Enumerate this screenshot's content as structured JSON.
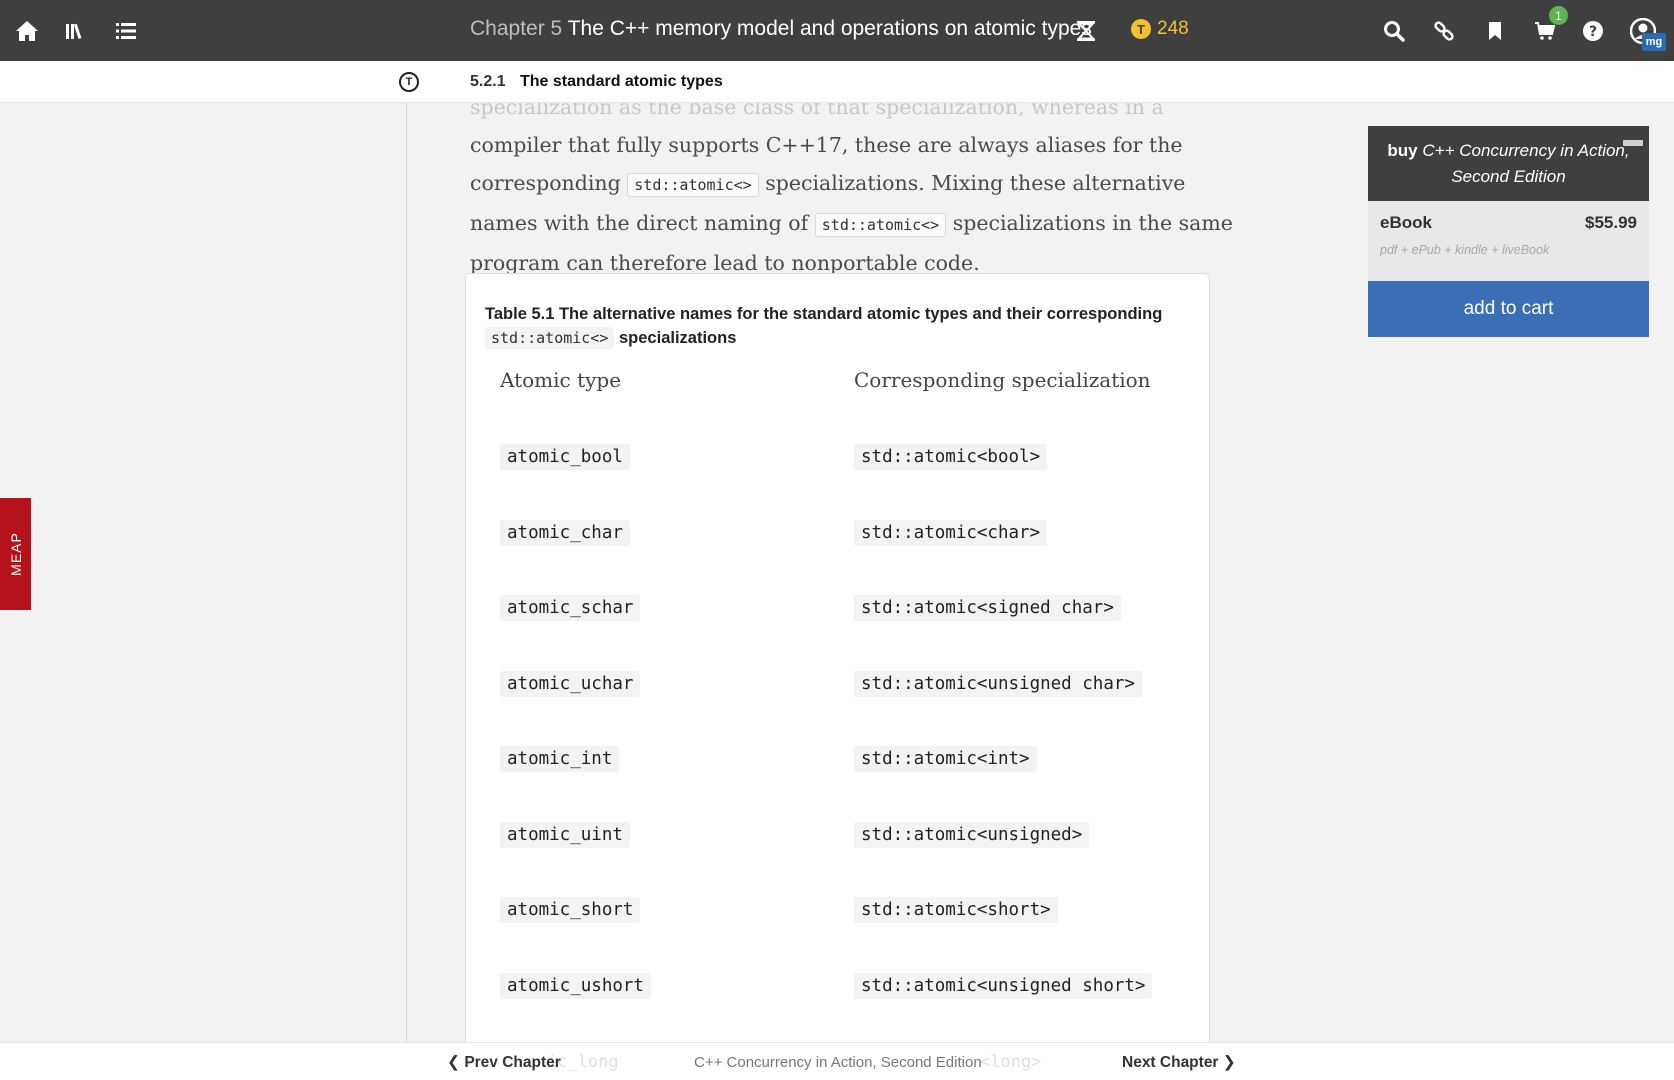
{
  "topbar": {
    "chapter_prefix": "Chapter 5",
    "chapter_title": "The C++ memory model and operations on atomic types",
    "token_symbol": "T",
    "token_count": "248",
    "cart_count": "1",
    "user_initials": "mg"
  },
  "subheader": {
    "toc_icon_letter": "T",
    "section_number": "5.2.1",
    "section_title": "The standard atomic types"
  },
  "meap_label": "MEAP",
  "body": {
    "line0": "specialization as the base class of that specialization, whereas in a",
    "line1": "compiler that fully supports C++17, these are always aliases for the",
    "line2_a": "corresponding",
    "line2_code": "std::atomic<>",
    "line2_b": "specializations. Mixing these alternative",
    "line3_a": "names with the direct naming of",
    "line3_code": "std::atomic<>",
    "line3_b": "specializations in the same",
    "line4": "program can therefore lead to nonportable code."
  },
  "table": {
    "caption_text": "Table 5.1 The alternative names for the standard atomic types and their corresponding",
    "caption_code": "std::atomic<>",
    "caption_tail": "specializations",
    "col1_header": "Atomic type",
    "col2_header": "Corresponding specialization",
    "rows": [
      {
        "type": "atomic_bool",
        "spec": "std::atomic<bool>"
      },
      {
        "type": "atomic_char",
        "spec": "std::atomic<char>"
      },
      {
        "type": "atomic_schar",
        "spec": "std::atomic<signed char>"
      },
      {
        "type": "atomic_uchar",
        "spec": "std::atomic<unsigned char>"
      },
      {
        "type": "atomic_int",
        "spec": "std::atomic<int>"
      },
      {
        "type": "atomic_uint",
        "spec": "std::atomic<unsigned>"
      },
      {
        "type": "atomic_short",
        "spec": "std::atomic<short>"
      },
      {
        "type": "atomic_ushort",
        "spec": "std::atomic<unsigned short>"
      }
    ],
    "partial_type": "ic_long",
    "partial_spec": "<long>"
  },
  "buy": {
    "buy_word": "buy",
    "book_title": "C++ Concurrency in Action, Second Edition",
    "ebook_label": "eBook",
    "ebook_price": "$55.99",
    "ebook_formats": "pdf + ePub + kindle + liveBook",
    "add_to_cart": "add to cart"
  },
  "bottom": {
    "prev": "Prev Chapter",
    "book": "C++ Concurrency in Action, Second Edition",
    "next": "Next Chapter"
  },
  "colors": {
    "topbar": "#3f3f3f",
    "accent_token": "#f2c12e",
    "meap": "#b5121b",
    "add_to_cart": "#3b6fb5",
    "cart_badge": "#5ab552"
  }
}
